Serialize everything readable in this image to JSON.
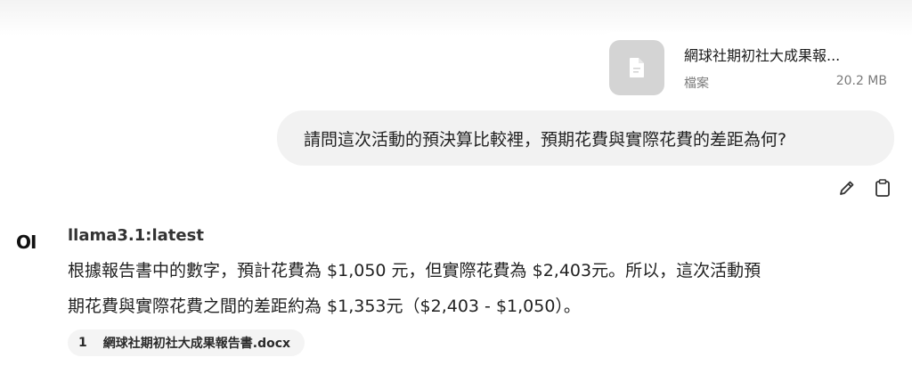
{
  "attachment": {
    "file_name": "網球社期初社大成果報...",
    "file_type_label": "檔案",
    "file_size": "20.2 MB",
    "icon": "document-icon"
  },
  "user_message": {
    "text": "請問這次活動的預決算比較裡，預期花費與實際花費的差距為何?"
  },
  "message_actions": {
    "edit_icon": "pencil-icon",
    "copy_icon": "clipboard-icon"
  },
  "assistant": {
    "avatar_text": "OI",
    "model_name": "llama3.1:latest",
    "answer_line1": "根據報告書中的數字，預計花費為 $1,050 元，但實際花費為 $2,403元。所以，這次活動預",
    "answer_line2": "期花費與實際花費之間的差距約為 $1,353元（$2,403 - $1,050）。",
    "citation": {
      "number": "1",
      "source": "網球社期初社大成果報告書.docx"
    }
  }
}
